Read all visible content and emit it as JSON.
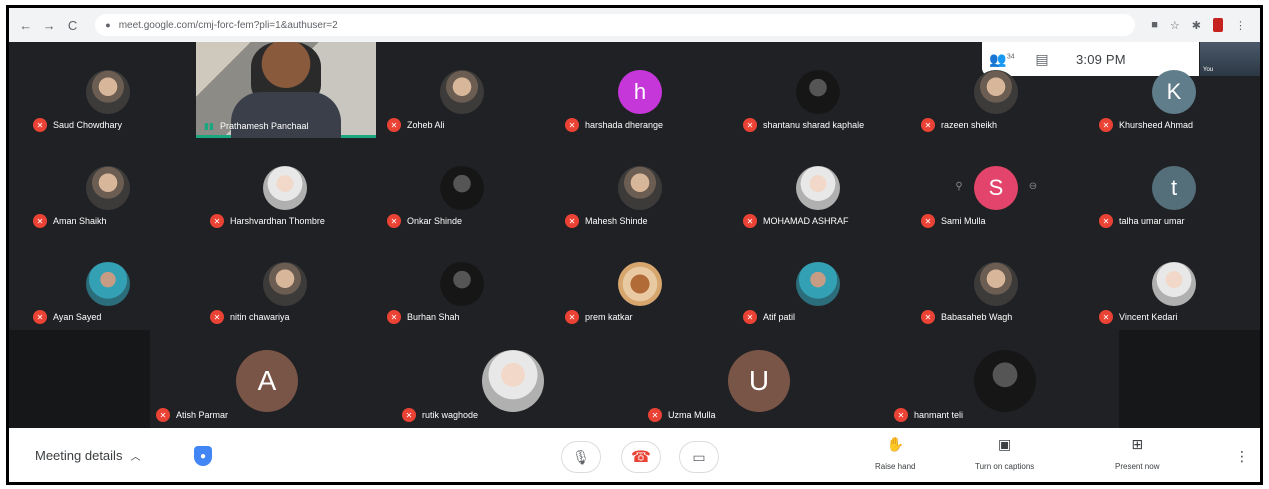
{
  "browser": {
    "url": "meet.google.com/cmj-forc-fem?pli=1&authuser=2",
    "back": "←",
    "forward": "→",
    "reload": "C",
    "lock": "🔒"
  },
  "toppill": {
    "people_icon": "people-icon",
    "people_count": "34",
    "chat_icon": "chat-icon",
    "time": "3:09 PM"
  },
  "self_tile": {
    "label": "You"
  },
  "presenter": {
    "name": "Prathamesh Panchaal"
  },
  "participants": [
    {
      "name": "Saud Chowdhary",
      "avatar": "",
      "style": "photo"
    },
    {
      "name": "Zoheb Ali",
      "avatar": "",
      "style": "photo"
    },
    {
      "name": "harshada dherange",
      "avatar": "h",
      "color": "#c537d8"
    },
    {
      "name": "shantanu sharad kaphale",
      "avatar": "",
      "style": "photo dark"
    },
    {
      "name": "razeen sheikh",
      "avatar": "",
      "style": "photo"
    },
    {
      "name": "Khursheed Ahmad",
      "avatar": "K",
      "color": "#607d8b"
    },
    {
      "name": "Aman Shaikh",
      "avatar": "",
      "style": "photo"
    },
    {
      "name": "Harshvardhan Thombre",
      "avatar": "",
      "style": "photo light"
    },
    {
      "name": "Onkar Shinde",
      "avatar": "",
      "style": "photo dark"
    },
    {
      "name": "Mahesh Shinde",
      "avatar": "",
      "style": "photo"
    },
    {
      "name": "MOHAMAD ASHRAF",
      "avatar": "",
      "style": "photo light"
    },
    {
      "name": "Sami Mulla",
      "avatar": "S",
      "color": "#e2446b"
    },
    {
      "name": "talha umar umar",
      "avatar": "t",
      "color": "#546e7a"
    },
    {
      "name": "Ayan Sayed",
      "avatar": "",
      "style": "photo teal"
    },
    {
      "name": "nitin chawariya",
      "avatar": "",
      "style": "photo"
    },
    {
      "name": "Burhan Shah",
      "avatar": "",
      "style": "photo dark"
    },
    {
      "name": "prem katkar",
      "avatar": "",
      "style": "photo orange"
    },
    {
      "name": "Atif patil",
      "avatar": "",
      "style": "photo teal"
    },
    {
      "name": "Babasaheb Wagh",
      "avatar": "",
      "style": "photo"
    },
    {
      "name": "Vincent Kedari",
      "avatar": "",
      "style": "photo light"
    }
  ],
  "bottom_participants": [
    {
      "name": "Atish Parmar",
      "avatar": "A",
      "color": "#795548"
    },
    {
      "name": "rutik waghode",
      "avatar": "",
      "style": "photo light"
    },
    {
      "name": "Uzma Mulla",
      "avatar": "U",
      "color": "#795548"
    },
    {
      "name": "hanmant teli",
      "avatar": "",
      "style": "photo dark"
    }
  ],
  "bottom_bar": {
    "meeting_details": "Meeting details",
    "chevron": "^",
    "raise_hand": "Raise hand",
    "captions": "Turn on captions",
    "present": "Present now",
    "more": "⋮"
  },
  "colors": {
    "mic_off": "#ea4335",
    "end_call": "#ea4335",
    "speaking": "#1aa77f"
  }
}
